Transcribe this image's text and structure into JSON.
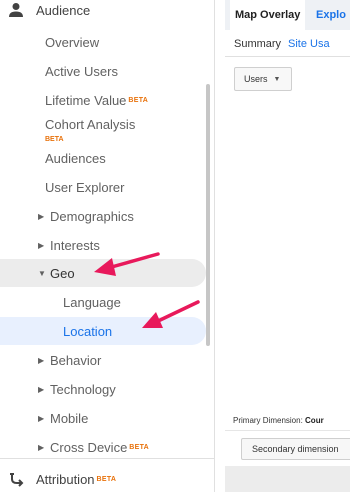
{
  "sidebar": {
    "section_title": "Audience",
    "items": [
      {
        "label": "Overview"
      },
      {
        "label": "Active Users"
      },
      {
        "label": "Lifetime Value",
        "badge": "BETA"
      },
      {
        "label": "Cohort Analysis",
        "badge": "BETA"
      },
      {
        "label": "Audiences"
      },
      {
        "label": "User Explorer"
      },
      {
        "label": "Demographics"
      },
      {
        "label": "Interests"
      },
      {
        "label": "Geo"
      },
      {
        "label": "Language"
      },
      {
        "label": "Location"
      },
      {
        "label": "Behavior"
      },
      {
        "label": "Technology"
      },
      {
        "label": "Mobile"
      },
      {
        "label": "Cross Device",
        "badge": "BETA"
      }
    ],
    "attribution": {
      "label": "Attribution",
      "badge": "BETA"
    }
  },
  "main": {
    "tabs": [
      {
        "label": "Map Overlay"
      },
      {
        "label": "Explo"
      }
    ],
    "subtabs": [
      {
        "label": "Summary"
      },
      {
        "label": "Site Usa"
      }
    ],
    "metric_select": {
      "value": "Users"
    },
    "primary_dimension": {
      "label": "Primary Dimension:",
      "value": "Cour"
    },
    "secondary_dimension": {
      "label": "Secondary dimension"
    }
  },
  "colors": {
    "accent": "#1a73e8",
    "beta": "#e8710a",
    "arrow": "#e8195b",
    "selected_bg": "#e8f0fe"
  },
  "icons": {
    "audience": "person-icon",
    "attribution": "attribution-icon",
    "collapsed": "chevron-right-icon",
    "expanded": "chevron-down-icon"
  }
}
